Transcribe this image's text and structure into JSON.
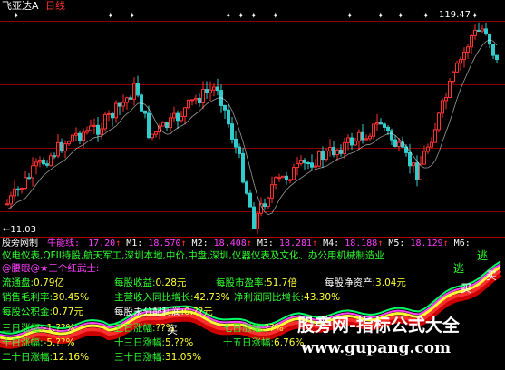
{
  "header": {
    "stock_name": "飞亚达A",
    "period": "日线"
  },
  "price": {
    "high_label": "19.47",
    "low_label": "11.03"
  },
  "indicator": {
    "name": "股旁网制",
    "label": "牛能线:",
    "value": "17.20",
    "ma": [
      {
        "label": "M1:",
        "value": "18.570"
      },
      {
        "label": "M2:",
        "value": "18.408"
      },
      {
        "label": "M3:",
        "value": "18.281"
      },
      {
        "label": "M4:",
        "value": "18.188"
      },
      {
        "label": "M5:",
        "value": "18.129"
      },
      {
        "label": "M6:",
        "value": ""
      }
    ]
  },
  "concepts": "仪电仪表,QFII持股,航天军工,深圳本地,中价,中盘,深圳,仪器仪表及文化、办公用机械制造业",
  "tag": "@腰眼@★三个红武士:",
  "financials": {
    "row1": [
      {
        "k": "流通盘:",
        "v": "0.79亿"
      },
      {
        "k": "每股收益:",
        "v": "0.28元"
      },
      {
        "k": "每股市盈率:",
        "v": "51.7倍"
      },
      {
        "k": "每股净资产:",
        "v": "3.04元"
      }
    ],
    "row2": [
      {
        "k": "销售毛利率:",
        "v": "30.45%"
      },
      {
        "k": "主营收入同比增长:",
        "v": "42.73%"
      },
      {
        "k": "净利润同比增长:",
        "v": "43.30%"
      }
    ],
    "row3": [
      {
        "k": "每股公积金:",
        "v": "0.77元"
      },
      {
        "k": "每股未分配利润:",
        "v": "0.??元"
      }
    ],
    "row4": [
      {
        "k": "三日涨幅:",
        "v": "-1.??%"
      },
      {
        "k": "五日涨幅:",
        "v": "??%"
      },
      {
        "k": "七日涨幅:",
        "v": "??%"
      }
    ],
    "row5": [
      {
        "k": "十日涨幅:",
        "v": "-5.??%"
      },
      {
        "k": "十三日涨幅:",
        "v": "5.??%"
      },
      {
        "k": "十五日涨幅:",
        "v": "6.76%"
      }
    ],
    "row6": [
      {
        "k": "二十日涨幅:",
        "v": "12.16%"
      },
      {
        "k": "三十日涨幅:",
        "v": "31.05%"
      }
    ]
  },
  "signals": {
    "buy": "买",
    "escape": "逃"
  },
  "watermark": {
    "title": "股旁网-指标公式大全",
    "url": "www.gupang.com"
  },
  "colors": {
    "background": "#000000",
    "up_candle": "#ff3030",
    "down_candle": "#33cccc",
    "grid": "#8a0000",
    "ma_line": "#ff3030"
  }
}
